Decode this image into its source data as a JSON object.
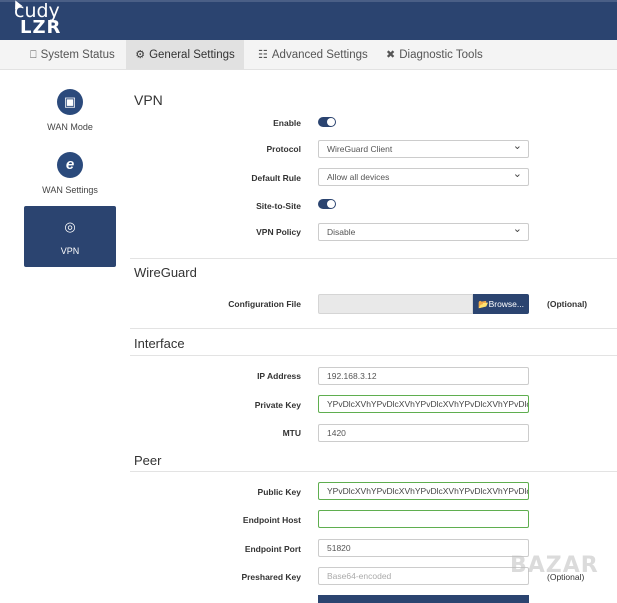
{
  "header": {
    "logo_line1": "cudy",
    "logo_line2": "LZR"
  },
  "tabs": [
    {
      "label": "System Status",
      "icon": "monitor-icon",
      "glyph": "⎕"
    },
    {
      "label": "General Settings",
      "icon": "gear-icon",
      "glyph": "⚙"
    },
    {
      "label": "Advanced Settings",
      "icon": "sliders-icon",
      "glyph": "☷"
    },
    {
      "label": "Diagnostic Tools",
      "icon": "tools-icon",
      "glyph": "✖"
    }
  ],
  "sidebar": {
    "items": [
      {
        "label": "WAN Mode",
        "icon": "wan-mode-icon",
        "glyph": "▣"
      },
      {
        "label": "WAN Settings",
        "icon": "internet-explorer-icon",
        "glyph": "e"
      },
      {
        "label": "VPN",
        "icon": "globe-icon",
        "glyph": "◎"
      }
    ]
  },
  "vpn": {
    "title": "VPN",
    "enable_label": "Enable",
    "enable_on": true,
    "protocol_label": "Protocol",
    "protocol_value": "WireGuard Client",
    "default_rule_label": "Default Rule",
    "default_rule_value": "Allow all devices",
    "site_to_site_label": "Site-to-Site",
    "site_to_site_on": true,
    "vpn_policy_label": "VPN Policy",
    "vpn_policy_value": "Disable"
  },
  "wireguard": {
    "title": "WireGuard",
    "config_file_label": "Configuration File",
    "browse_label": "📂Browse...",
    "optional": "(Optional)"
  },
  "interface": {
    "title": "Interface",
    "ip_label": "IP Address",
    "ip_value": "192.168.3.12",
    "private_key_label": "Private Key",
    "private_key_value": "YPvDlcXVhYPvDlcXVhYPvDlcXVhYPvDlcXVhYPvDlc",
    "mtu_label": "MTU",
    "mtu_value": "1420"
  },
  "peer": {
    "title": "Peer",
    "public_key_label": "Public Key",
    "public_key_value": "YPvDlcXVhYPvDlcXVhYPvDlcXVhYPvDlcXVhYPvDlc",
    "endpoint_host_label": "Endpoint Host",
    "endpoint_host_value": "",
    "endpoint_port_label": "Endpoint Port",
    "endpoint_port_value": "51820",
    "preshared_key_label": "Preshared Key",
    "preshared_key_placeholder": "Base64-encoded",
    "optional": "(Optional)"
  },
  "watermark": "BAZAR",
  "colors": {
    "header": "#2b4470",
    "accent": "#2b4a7c",
    "green_border": "#5fae4f"
  }
}
